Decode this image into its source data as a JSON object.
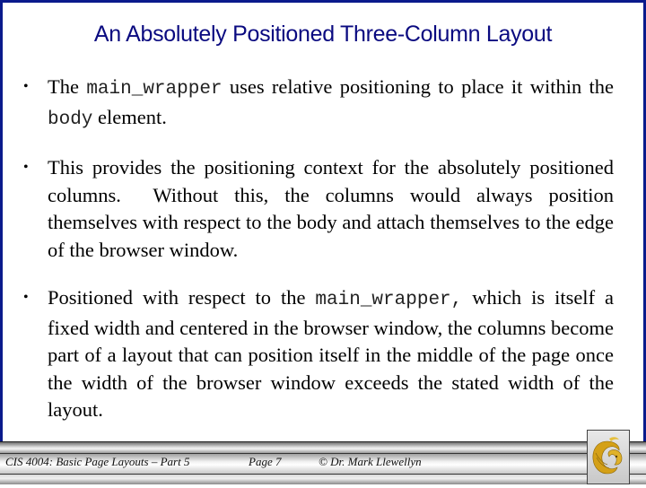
{
  "slide": {
    "title": "An Absolutely Positioned Three-Column Layout",
    "bullets": [
      {
        "parts": [
          {
            "text": "The ",
            "code": false
          },
          {
            "text": "main_wrapper",
            "code": true
          },
          {
            "text": " uses relative positioning to place it within the ",
            "code": false
          },
          {
            "text": "body",
            "code": true
          },
          {
            "text": " element.",
            "code": false
          }
        ]
      },
      {
        "parts": [
          {
            "text": "This provides the positioning context for the absolutely positioned columns.  Without this, the columns would always position themselves with respect to the body and attach themselves to the edge of the browser window.",
            "code": false
          }
        ]
      },
      {
        "parts": [
          {
            "text": "Positioned with respect to the ",
            "code": false
          },
          {
            "text": "main_wrapper,",
            "code": true
          },
          {
            "text": " which is itself a fixed width and centered in the browser window, the columns become part of a layout that can position itself in the middle of the page once the width of the browser window exceeds the stated width of the layout.",
            "code": false
          }
        ]
      }
    ],
    "bullet_glyph": "•"
  },
  "footer": {
    "course": "CIS 4004: Basic Page Layouts – Part 5",
    "page": "Page 7",
    "author": "© Dr. Mark Llewellyn",
    "logo_icon": "ucf-pegasus-logo-icon"
  },
  "colors": {
    "border": "#0a1a8c",
    "title": "#0a0a80",
    "logo_gold": "#d4a017"
  }
}
